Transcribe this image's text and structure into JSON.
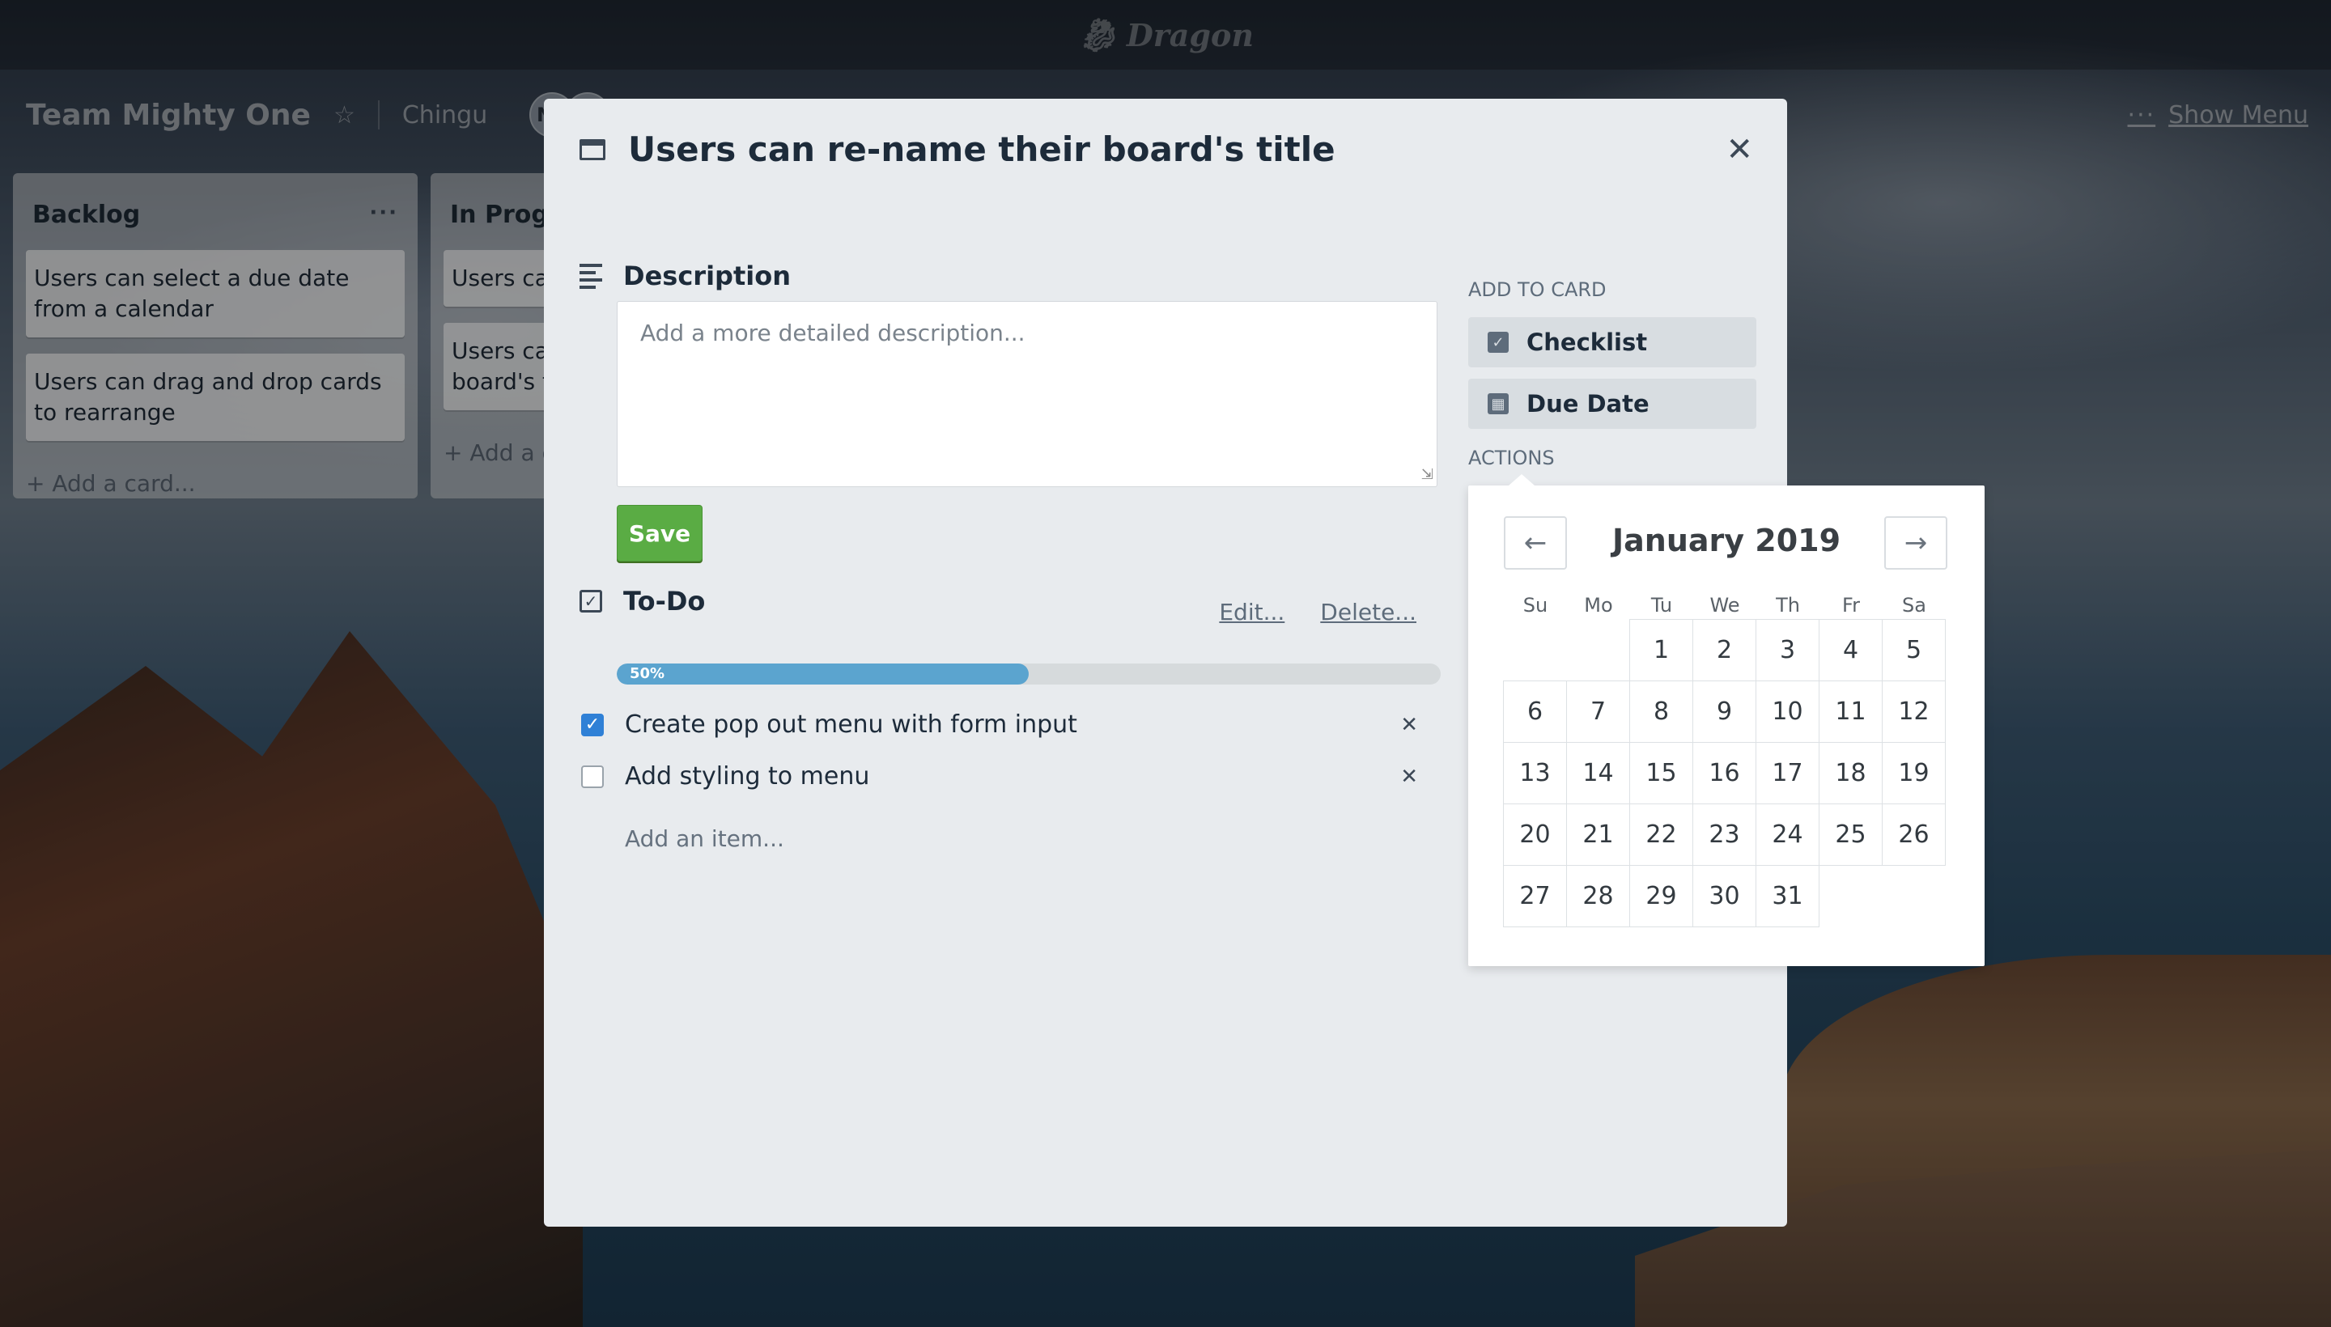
{
  "app": {
    "logo_text": "Dragon",
    "board_title": "Team Mighty One",
    "team": "Chingu",
    "member_initials": [
      "NR",
      "C"
    ],
    "show_menu": "Show Menu"
  },
  "lists": [
    {
      "title": "Backlog",
      "cards": [
        "Users can select a due date from a calendar",
        "Users can drag and drop cards to rearrange"
      ],
      "add_card": "+ Add a card..."
    },
    {
      "title": "In Progress",
      "cards": [
        "Users can change background",
        "Users can re-name their board's title"
      ],
      "add_card": "+ Add a card..."
    }
  ],
  "modal": {
    "title": "Users can re-name their board's title",
    "description_heading": "Description",
    "description_placeholder": "Add a more detailed description...",
    "save_label": "Save",
    "checklist": {
      "title": "To-Do",
      "edit_label": "Edit...",
      "delete_label": "Delete...",
      "progress_percent": 50,
      "progress_label": "50%",
      "items": [
        {
          "text": "Create pop out menu with form input",
          "checked": true
        },
        {
          "text": "Add styling to menu",
          "checked": false
        }
      ],
      "add_item": "Add an item..."
    },
    "sidebar": {
      "add_to_card_label": "ADD TO CARD",
      "checklist_button": "Checklist",
      "due_date_button": "Due Date",
      "actions_label": "ACTIONS"
    }
  },
  "calendar": {
    "month_label": "January 2019",
    "prev_icon": "arrow-left-icon",
    "next_icon": "arrow-right-icon",
    "weekdays": [
      "Su",
      "Mo",
      "Tu",
      "We",
      "Th",
      "Fr",
      "Sa"
    ],
    "leading_blanks": 2,
    "days": [
      "1",
      "2",
      "3",
      "4",
      "5",
      "6",
      "7",
      "8",
      "9",
      "10",
      "11",
      "12",
      "13",
      "14",
      "15",
      "16",
      "17",
      "18",
      "19",
      "20",
      "21",
      "22",
      "23",
      "24",
      "25",
      "26",
      "27",
      "28",
      "29",
      "30",
      "31"
    ]
  },
  "colors": {
    "accent_green": "#5aac44",
    "progress_blue": "#5ba4cf",
    "checked_blue": "#2f80d6"
  }
}
